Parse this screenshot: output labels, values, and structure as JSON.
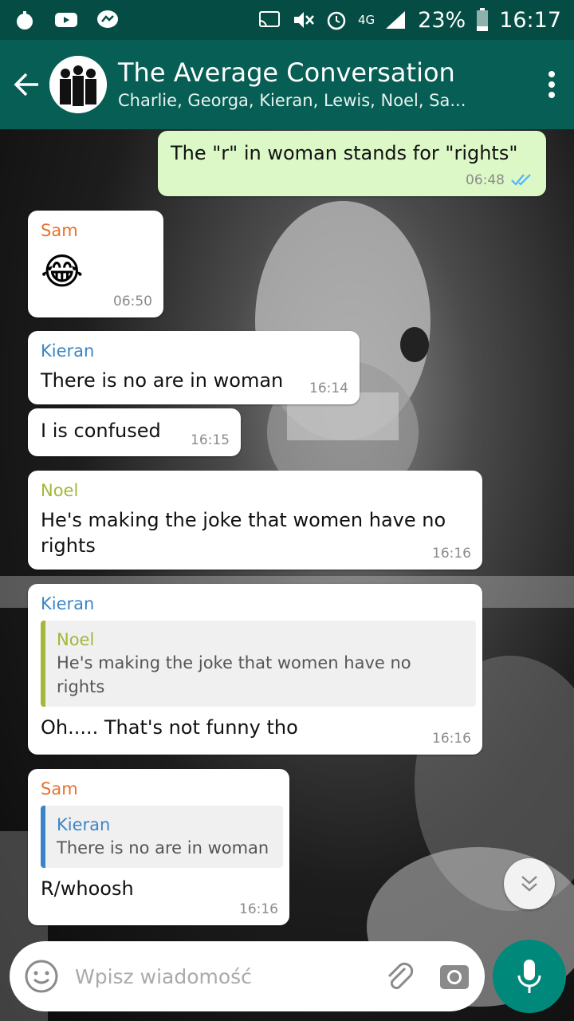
{
  "status_bar": {
    "battery": "23%",
    "clock": "16:17",
    "network": "4G"
  },
  "header": {
    "title": "The Average Conversation",
    "subtitle": "Charlie, Georga, Kieran, Lewis, Noel, Sa..."
  },
  "colors": {
    "header": "#075e54",
    "status_bar": "#054d44",
    "outgoing_bubble": "#dcf8c6",
    "sam": "#e8722c",
    "kieran": "#3b85c6",
    "noel": "#a3b73a",
    "mic": "#00897b",
    "read_ticks": "#4fb3ff"
  },
  "messages": [
    {
      "direction": "outgoing",
      "text": "The \"r\" in woman stands for \"rights\"",
      "time": "06:48",
      "status": "read"
    },
    {
      "direction": "incoming",
      "sender": "Sam",
      "emoji": "😂",
      "time": "06:50"
    },
    {
      "direction": "incoming",
      "sender": "Kieran",
      "text": "There is no are in woman",
      "time": "16:14"
    },
    {
      "direction": "incoming",
      "text": "I is confused",
      "time": "16:15"
    },
    {
      "direction": "incoming",
      "sender": "Noel",
      "text": "He's making the joke that women have no rights",
      "time": "16:16"
    },
    {
      "direction": "incoming",
      "sender": "Kieran",
      "quote": {
        "sender": "Noel",
        "text": "He's making the joke that women have no rights"
      },
      "text": "Oh..... That's not funny tho",
      "time": "16:16"
    },
    {
      "direction": "incoming",
      "sender": "Sam",
      "quote": {
        "sender": "Kieran",
        "text": "There is no are in woman"
      },
      "text": "R/whoosh",
      "time": "16:16"
    }
  ],
  "composer": {
    "placeholder": "Wpisz wiadomość"
  },
  "icons": {
    "back": "arrow-left-icon",
    "menu": "more-vert-icon",
    "emoji": "emoji-icon",
    "attach": "paperclip-icon",
    "camera": "camera-icon",
    "mic": "microphone-icon",
    "scroll": "double-chevron-down-icon"
  }
}
